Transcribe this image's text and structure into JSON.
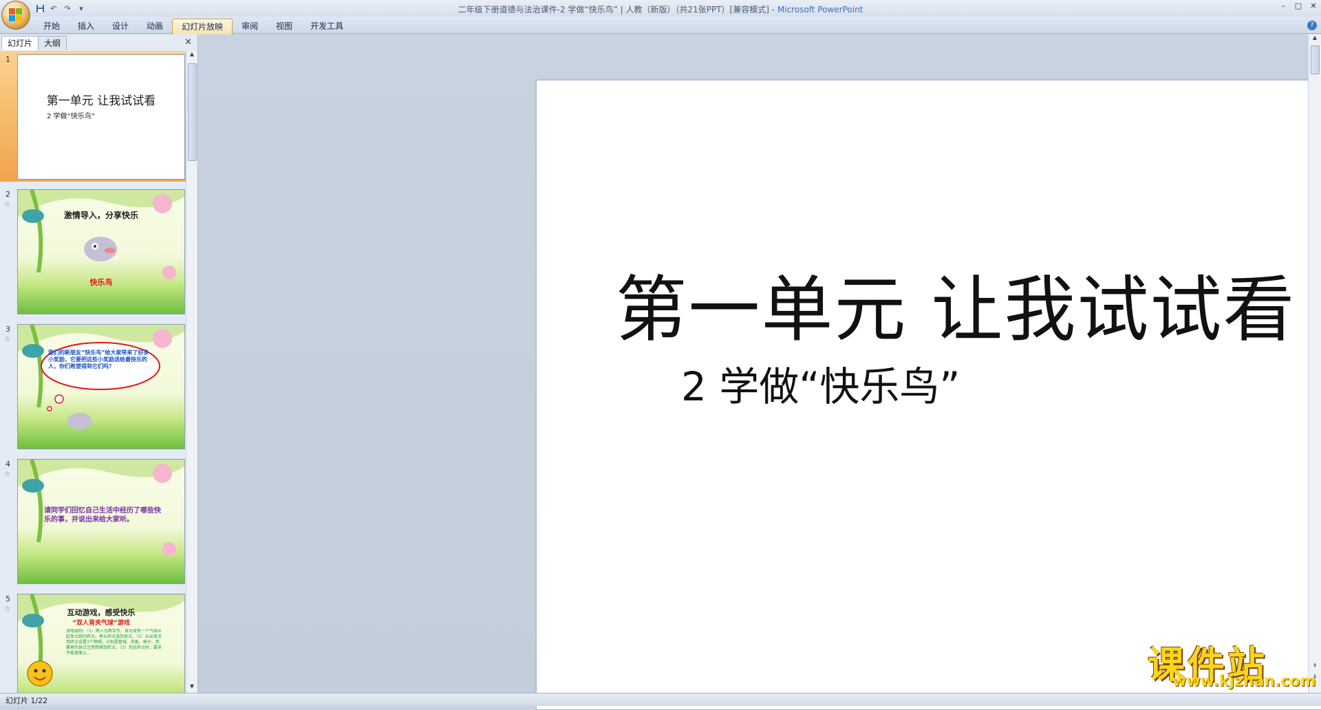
{
  "window": {
    "title": "二年级下册道德与法治课件-2  学做“快乐鸟”  | 人教（新版）（共21张PPT）[兼容模式] - ",
    "app_name": "Microsoft PowerPoint"
  },
  "ribbon": {
    "tabs": [
      {
        "label": "开始"
      },
      {
        "label": "插入"
      },
      {
        "label": "设计"
      },
      {
        "label": "动画"
      },
      {
        "label": "幻灯片放映"
      },
      {
        "label": "审阅"
      },
      {
        "label": "视图"
      },
      {
        "label": "开发工具"
      }
    ],
    "active_tab": "幻灯片放映"
  },
  "left_pane": {
    "tabs": [
      {
        "label": "幻灯片"
      },
      {
        "label": "大纲"
      }
    ],
    "thumbnails": [
      {
        "num": "1",
        "title": "第一单元  让我试试看",
        "subtitle": "2  学做“快乐鸟”"
      },
      {
        "num": "2",
        "title": "激情导入，分享快乐",
        "caption": "快乐鸟"
      },
      {
        "num": "3",
        "bubble": "我们的新朋友“快乐鸟”给大家带来了好多小奖励，它要把这些小奖励送给最快乐的人，你们希望得到它们吗？"
      },
      {
        "num": "4",
        "body": "请同学们回忆自己生活中经历了哪些快乐的事，并说出来给大家听。"
      },
      {
        "num": "5",
        "title": "互动游戏，感受快乐",
        "subtitle": "“双人背夹气球”游戏",
        "body": "游戏规则：（1）两人为两合作，背对背夹一个气球从起发点跑向终点，再从终点返回发点。（2）从出发点到终点设置3个障碍。分别是管钱、热板、椅子。参赛者的球过注意障碍到终点。（3）到达终点时，要求不能拿面上…"
      }
    ]
  },
  "slide": {
    "title": "第一单元  让我试试看",
    "subtitle": "2  学做“快乐鸟”"
  },
  "status": {
    "slide_indicator": "幻灯片 1/22"
  },
  "watermark": {
    "brand": "课件站",
    "url": "www.kjzhan.com"
  }
}
